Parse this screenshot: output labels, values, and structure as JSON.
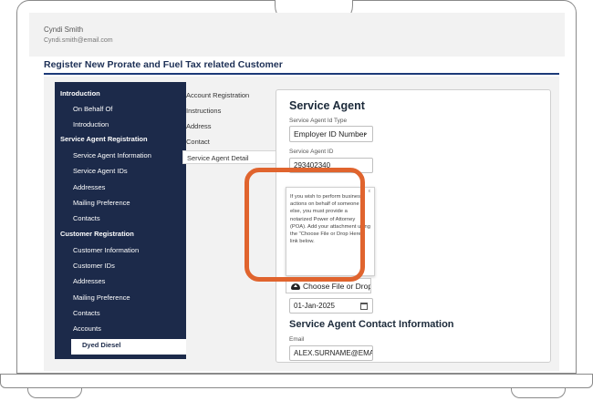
{
  "user": {
    "name": "Cyndi Smith",
    "email": "Cyndi.smith@email.com"
  },
  "page_heading": "Register New Prorate and Fuel Tax related Customer",
  "sidebar": {
    "items": [
      {
        "label": "Introduction",
        "type": "section"
      },
      {
        "label": "On Behalf Of",
        "type": "sub"
      },
      {
        "label": "Introduction",
        "type": "sub"
      },
      {
        "label": "Service Agent Registration",
        "type": "section"
      },
      {
        "label": "Service Agent Information",
        "type": "sub"
      },
      {
        "label": "Service Agent IDs",
        "type": "sub"
      },
      {
        "label": "Addresses",
        "type": "sub"
      },
      {
        "label": "Mailing Preference",
        "type": "sub"
      },
      {
        "label": "Contacts",
        "type": "sub"
      },
      {
        "label": "Customer Registration",
        "type": "section"
      },
      {
        "label": "Customer Information",
        "type": "sub"
      },
      {
        "label": "Customer IDs",
        "type": "sub"
      },
      {
        "label": "Addresses",
        "type": "sub"
      },
      {
        "label": "Mailing Preference",
        "type": "sub"
      },
      {
        "label": "Contacts",
        "type": "sub"
      },
      {
        "label": "Accounts",
        "type": "sub"
      },
      {
        "label": "Dyed Diesel",
        "type": "active"
      }
    ]
  },
  "steps": [
    {
      "label": "Account Registration"
    },
    {
      "label": "Instructions"
    },
    {
      "label": "Address"
    },
    {
      "label": "Contact"
    },
    {
      "label": "Service Agent Detail",
      "active": true
    }
  ],
  "panel": {
    "title": "Service Agent",
    "id_type_label": "Service Agent Id Type",
    "id_type_value": "Employer ID Number",
    "id_label": "Service Agent ID",
    "id_value": "293402340",
    "tooltip": "If you wish to perform business actions on behalf of someone else, you must provide a notarized Power of Attorney (POA). Add your attachment using the \"Choose File or Drop Here\" link below.",
    "tooltip_close": "x",
    "file_button": "Choose File or Drop Here",
    "date_value": "01-Jan-2025",
    "contact_title": "Service Agent Contact Information",
    "email_label": "Email",
    "email_value": "ALEX.SURNAME@EMAIL.COM"
  },
  "colors": {
    "sidebar_bg": "#1c2a4a",
    "highlight": "#e0642e",
    "heading_rule": "#1c3a78"
  }
}
